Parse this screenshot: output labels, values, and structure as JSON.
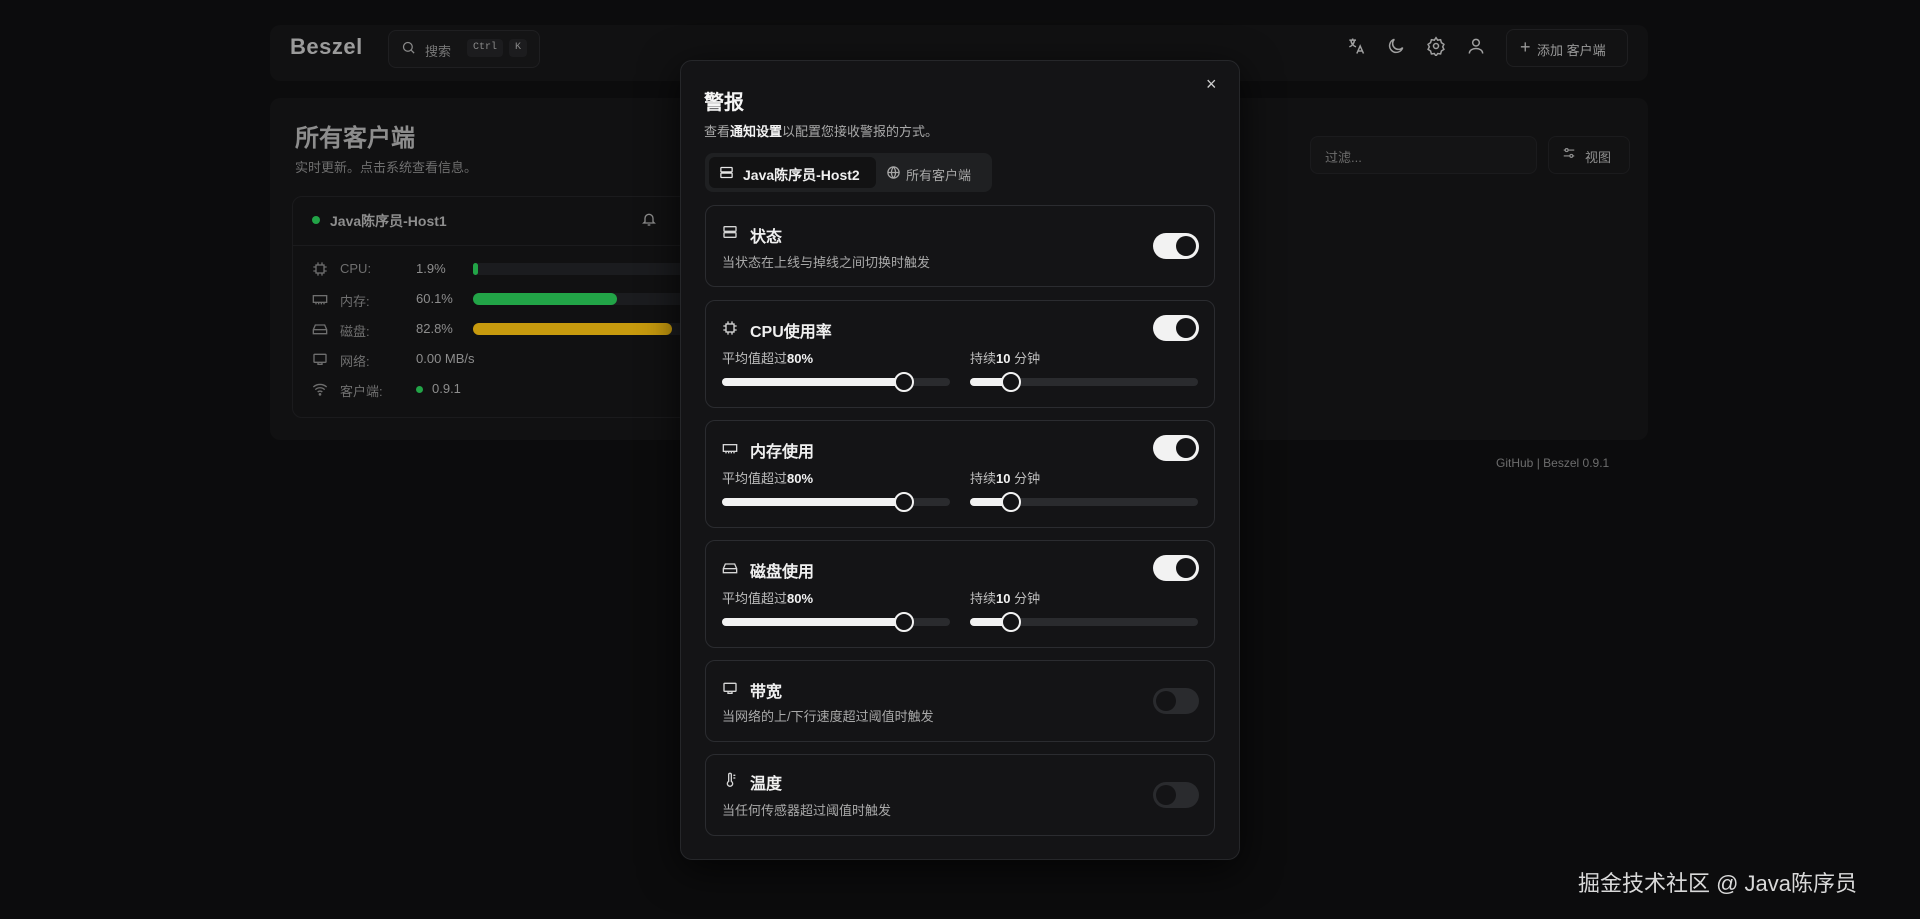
{
  "app": {
    "logo": "Beszel"
  },
  "search": {
    "label": "搜索",
    "kbd_ctrl": "Ctrl",
    "kbd_k": "K"
  },
  "nav": {
    "add_label": "添加 客户端"
  },
  "main": {
    "title": "所有客户端",
    "subtitle": "实时更新。点击系统查看信息。",
    "filter_placeholder": "过滤...",
    "view_label": "视图"
  },
  "host": {
    "name": "Java陈序员-Host1",
    "metrics": [
      {
        "label": "CPU:",
        "value": "1.9%",
        "percent": 1.9,
        "color": "#22a447"
      },
      {
        "label": "内存:",
        "value": "60.1%",
        "percent": 60.1,
        "color": "#22a447"
      },
      {
        "label": "磁盘:",
        "value": "82.8%",
        "percent": 82.8,
        "color": "#c79a0e"
      },
      {
        "label": "网络:",
        "value": "0.00 MB/s"
      },
      {
        "label": "客户端:",
        "value": "0.9.1"
      }
    ]
  },
  "footer": {
    "github": "GitHub",
    "sep": "|",
    "version": "Beszel 0.9.1"
  },
  "modal": {
    "title": "警报",
    "sub_prefix": "查看",
    "sub_link": "通知设置",
    "sub_suffix": "以配置您接收警报的方式。",
    "close": "×",
    "tabs": [
      {
        "label": "Java陈序员-Host2",
        "active": true
      },
      {
        "label": "所有客户端",
        "active": false
      }
    ],
    "alerts": [
      {
        "title": "状态",
        "desc": "当状态在上线与掉线之间切换时触发",
        "enabled": true
      },
      {
        "title": "CPU使用率",
        "enabled": true,
        "threshold_prefix": "平均值超过",
        "threshold": "80%",
        "threshold_percent": 80,
        "duration_prefix": "持续",
        "duration": "10",
        "duration_unit": "分钟",
        "duration_percent": 18
      },
      {
        "title": "内存使用",
        "enabled": true,
        "threshold_prefix": "平均值超过",
        "threshold": "80%",
        "threshold_percent": 80,
        "duration_prefix": "持续",
        "duration": "10",
        "duration_unit": "分钟",
        "duration_percent": 18
      },
      {
        "title": "磁盘使用",
        "enabled": true,
        "threshold_prefix": "平均值超过",
        "threshold": "80%",
        "threshold_percent": 80,
        "duration_prefix": "持续",
        "duration": "10",
        "duration_unit": "分钟",
        "duration_percent": 18
      },
      {
        "title": "带宽",
        "desc": "当网络的上/下行速度超过阈值时触发",
        "enabled": false
      },
      {
        "title": "温度",
        "desc": "当任何传感器超过阈值时触发",
        "enabled": false
      }
    ]
  },
  "watermark": "掘金技术社区 @ Java陈序员"
}
